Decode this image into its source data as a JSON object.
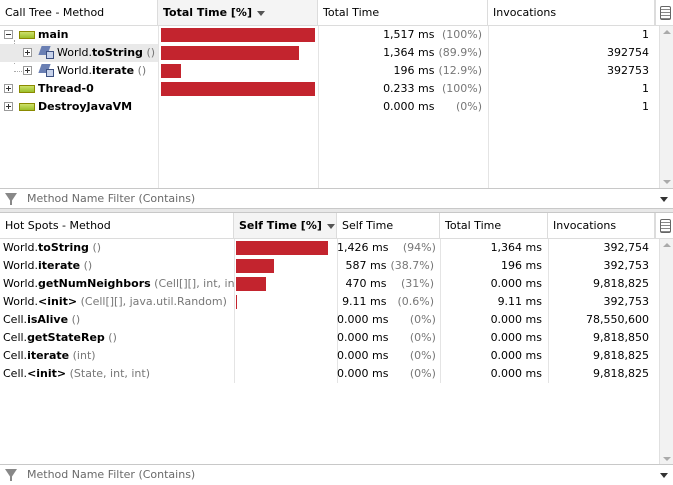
{
  "call_tree": {
    "columns": {
      "method": "Call Tree - Method",
      "total_time_pct": "Total Time [%]",
      "total_time": "Total Time",
      "invocations": "Invocations"
    },
    "rows": [
      {
        "cls": "",
        "method": "main",
        "params": "",
        "bar_pct": 100,
        "time": "1,517 ms",
        "pct": "(100%)",
        "invocations": "1"
      },
      {
        "cls": "World.",
        "method": "toString",
        "params": "()",
        "bar_pct": 89.9,
        "time": "1,364 ms",
        "pct": "(89.9%)",
        "invocations": "392754"
      },
      {
        "cls": "World.",
        "method": "iterate",
        "params": "()",
        "bar_pct": 12.9,
        "time": "196 ms",
        "pct": "(12.9%)",
        "invocations": "392753"
      },
      {
        "cls": "",
        "method": "Thread-0",
        "params": "",
        "bar_pct": 100,
        "time": "0.233 ms",
        "pct": "(100%)",
        "invocations": "1"
      },
      {
        "cls": "",
        "method": "DestroyJavaVM",
        "params": "",
        "bar_pct": 0,
        "time": "0.000 ms",
        "pct": "(0%)",
        "invocations": "1"
      }
    ],
    "filter_placeholder": "Method Name Filter (Contains)"
  },
  "hot_spots": {
    "columns": {
      "method": "Hot Spots - Method",
      "self_time_pct": "Self Time [%]",
      "self_time": "Self Time",
      "total_time": "Total Time",
      "invocations": "Invocations"
    },
    "rows": [
      {
        "cls": "World.",
        "method": "toString",
        "params": "()",
        "bar_pct": 94,
        "self_time": "1,426 ms",
        "pct": "(94%)",
        "total_time": "1,364 ms",
        "invocations": "392,754"
      },
      {
        "cls": "World.",
        "method": "iterate",
        "params": "()",
        "bar_pct": 38.7,
        "self_time": "587 ms",
        "pct": "(38.7%)",
        "total_time": "196 ms",
        "invocations": "392,753"
      },
      {
        "cls": "World.",
        "method": "getNumNeighbors",
        "params": "(Cell[][], int, int)",
        "bar_pct": 31,
        "self_time": "470 ms",
        "pct": "(31%)",
        "total_time": "0.000 ms",
        "invocations": "9,818,825"
      },
      {
        "cls": "World.",
        "method": "<init>",
        "params": "(Cell[][], java.util.Random)",
        "bar_pct": 0.6,
        "self_time": "9.11 ms",
        "pct": "(0.6%)",
        "total_time": "9.11 ms",
        "invocations": "392,753"
      },
      {
        "cls": "Cell.",
        "method": "isAlive",
        "params": "()",
        "bar_pct": 0,
        "self_time": "0.000 ms",
        "pct": "(0%)",
        "total_time": "0.000 ms",
        "invocations": "78,550,600"
      },
      {
        "cls": "Cell.",
        "method": "getStateRep",
        "params": "()",
        "bar_pct": 0,
        "self_time": "0.000 ms",
        "pct": "(0%)",
        "total_time": "0.000 ms",
        "invocations": "9,818,850"
      },
      {
        "cls": "Cell.",
        "method": "iterate",
        "params": "(int)",
        "bar_pct": 0,
        "self_time": "0.000 ms",
        "pct": "(0%)",
        "total_time": "0.000 ms",
        "invocations": "9,818,825"
      },
      {
        "cls": "Cell.",
        "method": "<init>",
        "params": "(State, int, int)",
        "bar_pct": 0,
        "self_time": "0.000 ms",
        "pct": "(0%)",
        "total_time": "0.000 ms",
        "invocations": "9,818,825"
      }
    ],
    "filter_placeholder": "Method Name Filter (Contains)"
  },
  "colors": {
    "bar": "#c3242e"
  },
  "icons": [
    "expand-icon",
    "collapse-icon",
    "thread-icon",
    "method-icon",
    "filter-icon",
    "column-chooser-icon",
    "dropdown-arrow-icon"
  ]
}
